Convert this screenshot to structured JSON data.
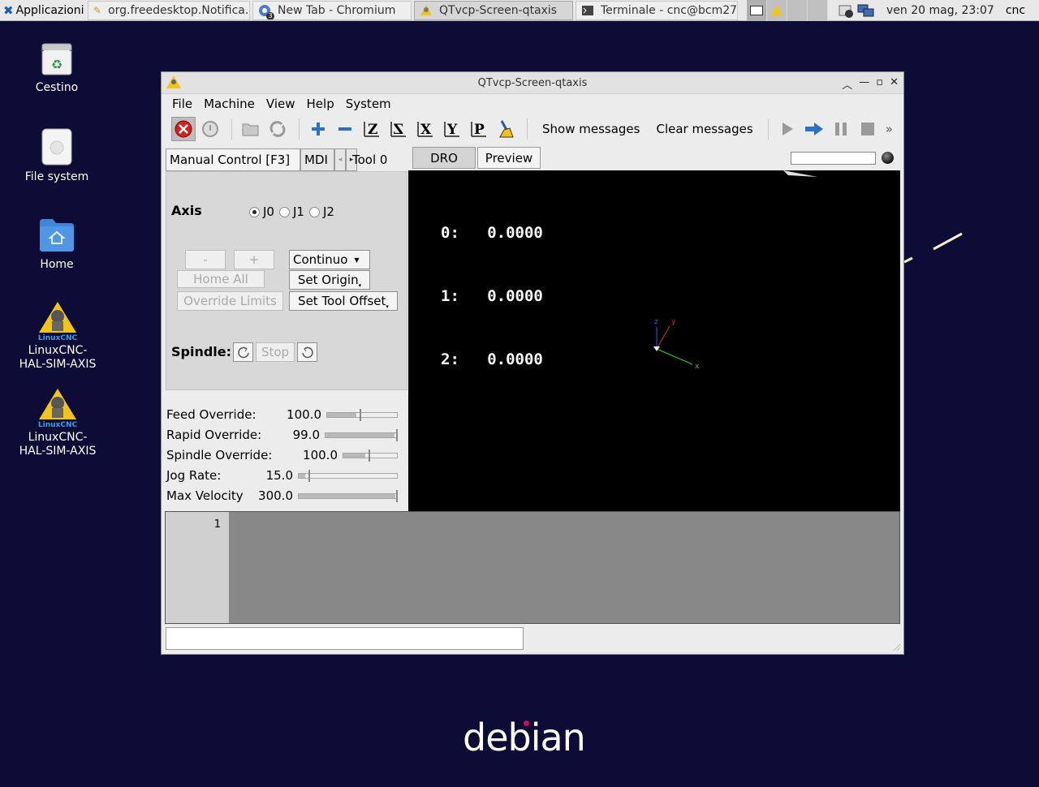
{
  "taskbar": {
    "apps_label": "Applicazioni",
    "tasks": [
      {
        "label": "org.freedesktop.Notifica...",
        "icon": "pencil-icon"
      },
      {
        "label": "New Tab - Chromium",
        "icon": "chromium-icon",
        "badge": "3"
      },
      {
        "label": "QTvcp-Screen-qtaxis",
        "icon": "linuxcnc-icon"
      },
      {
        "label": "Terminale - cnc@bcm27...",
        "icon": "terminal-icon"
      }
    ],
    "clock": "ven 20 mag, 23:07",
    "user": "cnc"
  },
  "desktop": {
    "icons": [
      {
        "label": "Cestino",
        "icon": "trash-icon"
      },
      {
        "label": "File system",
        "icon": "drive-icon"
      },
      {
        "label": "Home",
        "icon": "home-folder-icon"
      },
      {
        "label": "LinuxCNC-\nHAL-SIM-AXIS",
        "icon": "linuxcnc-icon",
        "logo_text": "LinuxCNC"
      },
      {
        "label": "LinuxCNC-\nHAL-SIM-AXIS",
        "icon": "linuxcnc-icon",
        "logo_text": "LinuxCNC"
      }
    ],
    "wallpaper_logo": "debian"
  },
  "window": {
    "title": "QTvcp-Screen-qtaxis",
    "menu": [
      "File",
      "Machine",
      "View",
      "Help",
      "System"
    ],
    "toolbar": {
      "show_messages": "Show messages",
      "clear_messages": "Clear messages",
      "overflow": "»"
    },
    "left_tabs": [
      "Manual Control [F3]",
      "MDI",
      "Tool 0"
    ],
    "manual": {
      "axis_label": "Axis",
      "axes": [
        "J0",
        "J1",
        "J2"
      ],
      "selected_axis": "J0",
      "minus_label": "-",
      "plus_label": "+",
      "jog_mode": "Continuo",
      "home_all": "Home All",
      "set_origin": "Set Origin",
      "override_limits": "Override Limits",
      "set_tool_offset": "Set Tool Offset",
      "spindle_label": "Spindle:",
      "stop_label": "Stop"
    },
    "sliders": [
      {
        "label": "Feed Override:",
        "value": "100.0",
        "fraction": 0.45
      },
      {
        "label": "Rapid Override:",
        "value": "99.0",
        "fraction": 0.99
      },
      {
        "label": "Spindle Override:",
        "value": "100.0",
        "fraction": 0.45
      },
      {
        "label": "Jog Rate:",
        "value": "15.0",
        "fraction": 0.1
      },
      {
        "label": "Max Velocity",
        "value": "300.0",
        "fraction": 1.0
      }
    ],
    "right_tabs": [
      "DRO",
      "Preview"
    ],
    "active_right_tab": "Preview",
    "dro": [
      {
        "axis": "0:",
        "value": "0.0000"
      },
      {
        "axis": "1:",
        "value": "0.0000"
      },
      {
        "axis": "2:",
        "value": "0.0000"
      }
    ],
    "gcode": {
      "line_number": "1"
    },
    "axis_labels": {
      "x": "x",
      "y": "y",
      "z": "z"
    },
    "colors": {
      "x_axis": "#33cc33",
      "y_axis": "#cc3333",
      "z_axis": "#3355ff"
    }
  }
}
